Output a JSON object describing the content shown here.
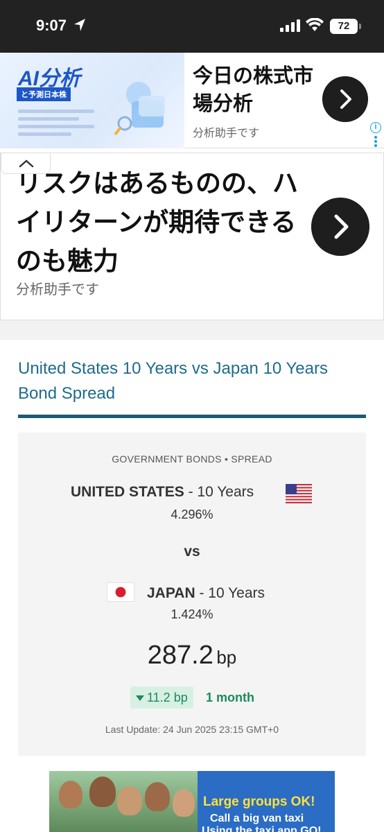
{
  "status_bar": {
    "time": "9:07",
    "battery": "72"
  },
  "ad_top": {
    "image_title": "AI分析",
    "image_sub": "と予測日本株",
    "title": "今日の株式市場分析",
    "advertiser": "分析助手です"
  },
  "ad_second": {
    "headline": "リスクはあるものの、ハイリターンが期待できるのも魅力",
    "advertiser": "分析助手です"
  },
  "page": {
    "heading": "United States 10 Years vs Japan 10 Years Bond Spread"
  },
  "spread_card": {
    "category": "GOVERNMENT BONDS • SPREAD",
    "country1": "UNITED STATES",
    "country1_term": " - 10 Years",
    "country1_yield": "4.296%",
    "vs": "vs",
    "country2": "JAPAN",
    "country2_term": " - 10 Years",
    "country2_yield": "1.424%",
    "spread_value": "287.2",
    "spread_unit": "bp",
    "change_value": "11.2 bp",
    "change_direction": "down",
    "change_period": "1 month",
    "last_update": "Last Update: 24 Jun 2025 23:15 GMT+0"
  },
  "ad_bottom": {
    "line1": "Large groups OK!",
    "line2": "Call a big van taxi",
    "line3": "Using the taxi app GO!"
  },
  "colors": {
    "heading": "#1e6b8c",
    "rule": "#1e5a72",
    "change_text": "#1c8a59",
    "change_bg": "#d7f0e3"
  }
}
